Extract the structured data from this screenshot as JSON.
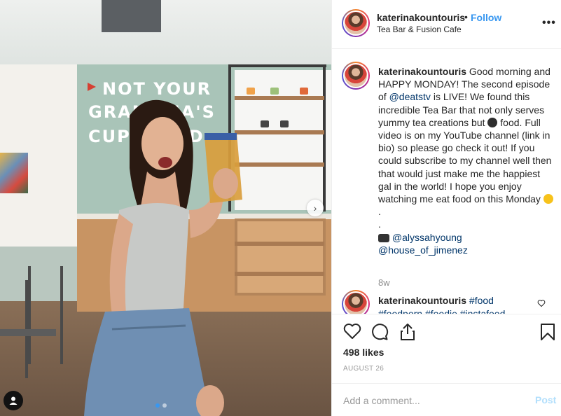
{
  "photo": {
    "wall_text": [
      "NOT YOUR",
      "GRA",
      "A'S",
      "CUR",
      "E"
    ],
    "wall_text_lines": {
      "line1": "NOT YOUR",
      "line2": "GRANDMA'S",
      "line3": "CUPBOARD"
    },
    "carousel_next": "›",
    "carousel": {
      "count": 2,
      "active": 1
    }
  },
  "header": {
    "username": "katerinakountouris",
    "separator": "•",
    "follow_label": "Follow",
    "location": "Tea Bar & Fusion Cafe",
    "more_label": "•••"
  },
  "caption": {
    "username": "katerinakountouris",
    "text_1": "Good morning and HAPPY MONDAY! The second episode of",
    "mention_1": "@deatstv",
    "text_2": "is LIVE! We found this incredible Tea Bar that not only serves yummy tea creations but",
    "text_3": "food. Full video is on my YouTube channel (link in bio) so please go check it out! If you could subscribe to my channel well then that would just make me the happiest gal in the world! I hope you enjoy watching me eat food on this Monday",
    "dot_1": ".",
    "dot_2": ".",
    "mention_2": "@alyssahyoung",
    "mention_3": "@house_of_jimenez"
  },
  "timestamp": "8w",
  "comment": {
    "username": "katerinakountouris",
    "hashtag": "#food",
    "cut_text": "#foodporn #foodie #instafood"
  },
  "actions": {
    "likes": "498 likes",
    "date": "AUGUST 26"
  },
  "add_comment": {
    "placeholder": "Add a comment...",
    "post_label": "Post"
  },
  "colors": {
    "link": "#3897f0",
    "mention": "#003569",
    "post_disabled": "#b2dffc"
  }
}
